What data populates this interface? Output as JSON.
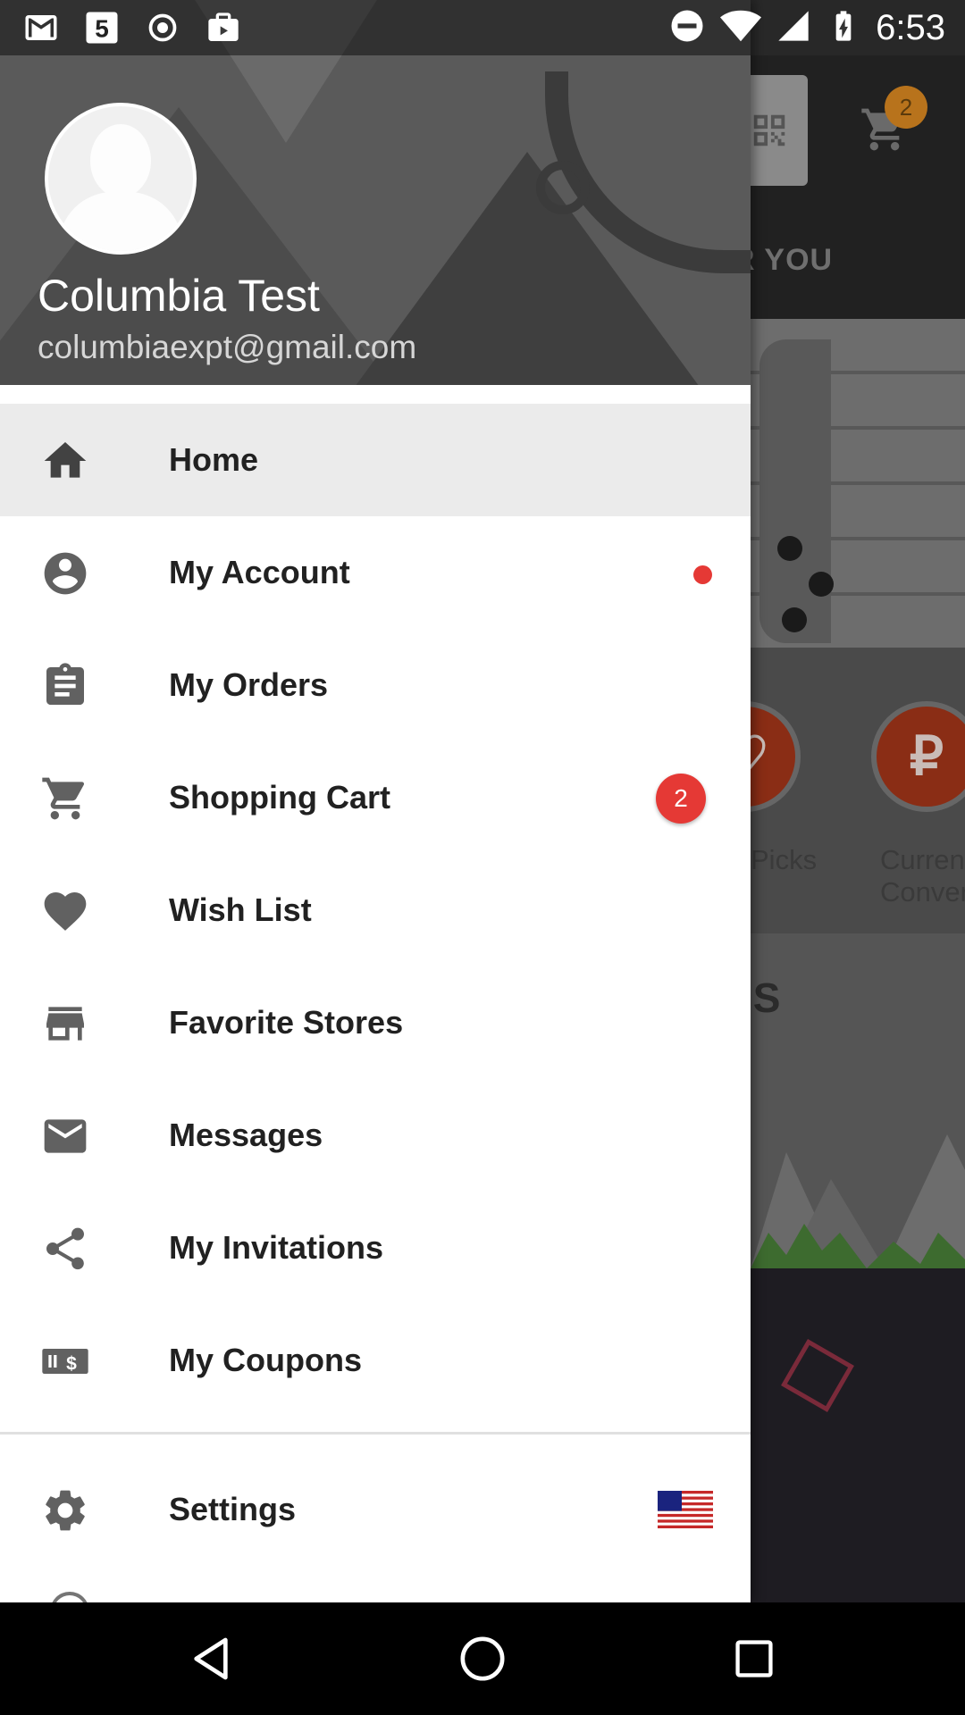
{
  "status_bar": {
    "time": "6:53",
    "left_icons": [
      "gmail-icon",
      "channel-5-icon",
      "record-icon",
      "media-icon"
    ],
    "right_icons": [
      "do-not-disturb-icon",
      "wifi-icon",
      "signal-icon",
      "battery-charging-icon"
    ]
  },
  "background_app": {
    "cart_badge": "2",
    "tab_fragment": "R YOU",
    "category_labels": [
      "Picks",
      "Curren\nConver"
    ],
    "section_fragment": "IS"
  },
  "drawer": {
    "user": {
      "name": "Columbia Test",
      "email": "columbiaexpt@gmail.com"
    },
    "menu_items": [
      {
        "label": "Home",
        "icon": "home-icon",
        "active": true
      },
      {
        "label": "My Account",
        "icon": "account-circle-icon",
        "indicator": "red-dot"
      },
      {
        "label": "My Orders",
        "icon": "clipboard-icon"
      },
      {
        "label": "Shopping Cart",
        "icon": "cart-icon",
        "badge": "2"
      },
      {
        "label": "Wish List",
        "icon": "heart-icon"
      },
      {
        "label": "Favorite Stores",
        "icon": "store-icon"
      },
      {
        "label": "Messages",
        "icon": "mail-icon"
      },
      {
        "label": "My Invitations",
        "icon": "share-icon"
      },
      {
        "label": "My Coupons",
        "icon": "coupon-icon"
      }
    ],
    "settings": {
      "label": "Settings",
      "icon": "gear-icon",
      "trailing": "us-flag-icon"
    }
  },
  "colors": {
    "accent_red": "#e53935",
    "icon_gray": "#616161",
    "text_dark": "#212121",
    "active_bg": "#ebebeb"
  }
}
